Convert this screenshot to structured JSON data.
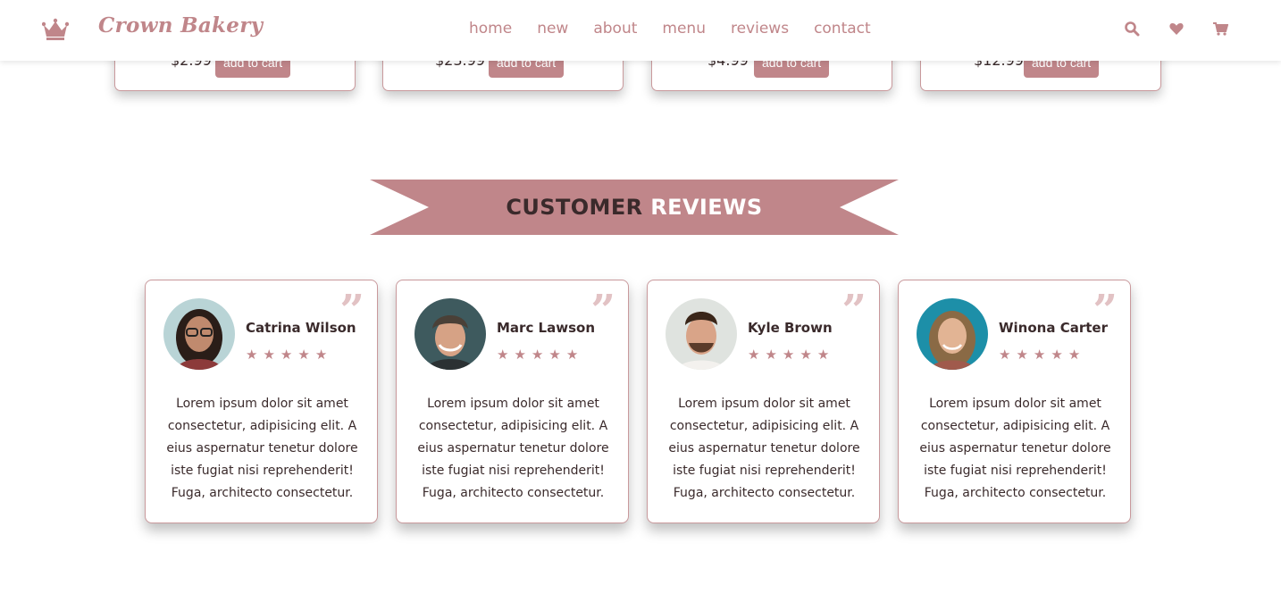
{
  "header": {
    "logo_icon": "crown-icon",
    "brand": "Crown Bakery",
    "nav": [
      "home",
      "new",
      "about",
      "menu",
      "reviews",
      "contact"
    ],
    "icons": [
      "search-icon",
      "heart-icon",
      "cart-icon"
    ]
  },
  "products": [
    {
      "price": "$2.99",
      "button": "add to cart"
    },
    {
      "price": "$23.99",
      "button": "add to cart"
    },
    {
      "price": "$4.99",
      "button": "add to cart"
    },
    {
      "price": "$12.99",
      "button": "add to cart"
    }
  ],
  "reviews_section": {
    "title_part1": "CUSTOMER",
    "title_part2": "REVIEWS",
    "quote_glyph": "”",
    "star_glyph": "★",
    "items": [
      {
        "name": "Catrina Wilson",
        "rating": 5,
        "text": "Lorem ipsum dolor sit amet consectetur, adipisicing elit. A eius aspernatur tenetur dolore iste fugiat nisi reprehenderit! Fuga, architecto consectetur."
      },
      {
        "name": "Marc Lawson",
        "rating": 5,
        "text": "Lorem ipsum dolor sit amet consectetur, adipisicing elit. A eius aspernatur tenetur dolore iste fugiat nisi reprehenderit! Fuga, architecto consectetur."
      },
      {
        "name": "Kyle Brown",
        "rating": 5,
        "text": "Lorem ipsum dolor sit amet consectetur, adipisicing elit. A eius aspernatur tenetur dolore iste fugiat nisi reprehenderit! Fuga, architecto consectetur."
      },
      {
        "name": "Winona Carter",
        "rating": 5,
        "text": "Lorem ipsum dolor sit amet consectetur, adipisicing elit. A eius aspernatur tenetur dolore iste fugiat nisi reprehenderit! Fuga, architecto consectetur."
      }
    ]
  },
  "colors": {
    "accent": "#c0868a",
    "text": "#3a2a2b",
    "quote": "#e2c2c4"
  }
}
